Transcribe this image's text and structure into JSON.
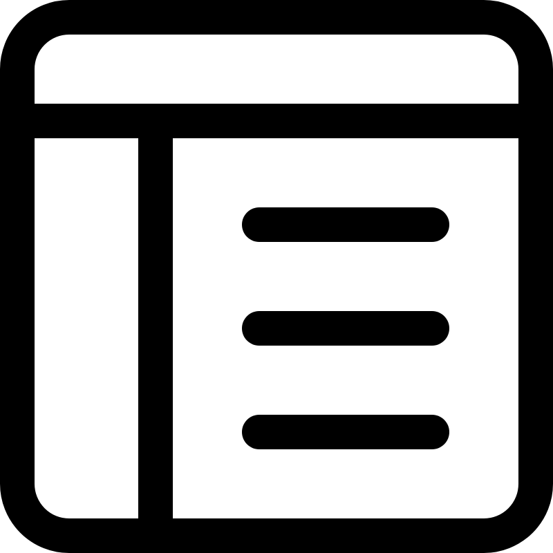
{
  "icon": {
    "name": "window-sidebar-list-icon",
    "stroke_color": "#000000",
    "background_color": "#ffffff"
  }
}
